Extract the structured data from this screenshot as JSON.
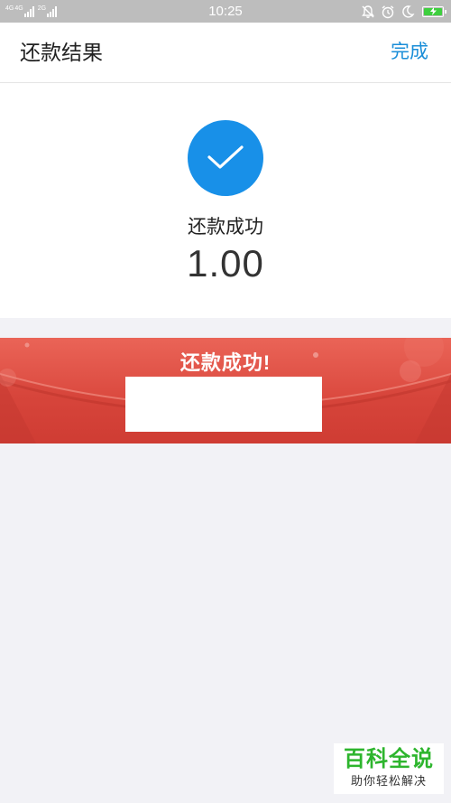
{
  "status_bar": {
    "network1": "4G",
    "network2": "4G",
    "network3": "2G",
    "time": "10:25",
    "icons": [
      "bell-muted-icon",
      "alarm-icon",
      "moon-icon",
      "battery-charging-icon"
    ]
  },
  "header": {
    "title": "还款结果",
    "done_label": "完成"
  },
  "result": {
    "status": "还款成功",
    "amount": "1.00",
    "icon": "check-icon"
  },
  "banner": {
    "text": "还款成功!"
  },
  "watermark": {
    "title": "百科全说",
    "subtitle": "助你轻松解决"
  },
  "colors": {
    "accent_blue": "#1890e8",
    "link_blue": "#1a8ed8",
    "banner_red": "#d7453b",
    "background": "#f2f2f6",
    "watermark_green": "#2db52d"
  }
}
